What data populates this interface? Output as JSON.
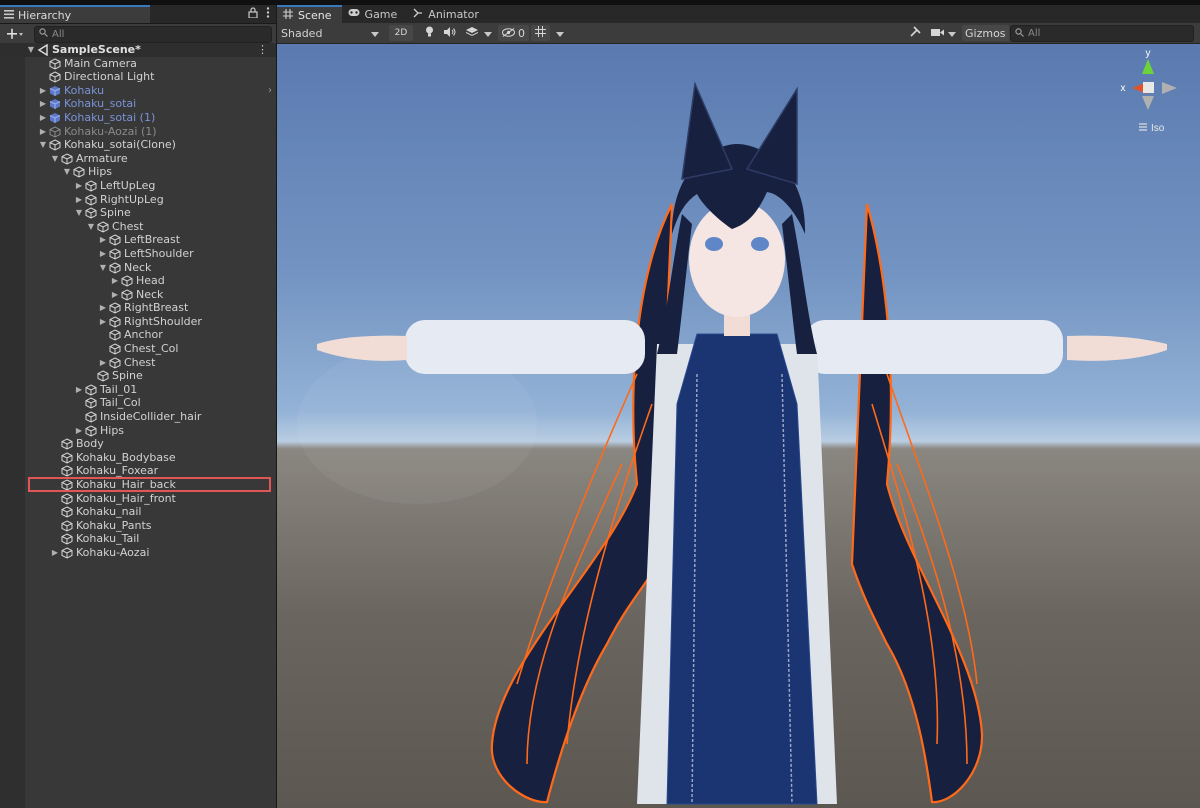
{
  "hierarchy": {
    "tab_label": "Hierarchy",
    "search_placeholder": "All",
    "rows": [
      {
        "label": "SampleScene*",
        "depth": 0,
        "arrow": "open",
        "icon": "scene",
        "kind": "scene"
      },
      {
        "label": "Main Camera",
        "depth": 1,
        "arrow": "none",
        "icon": "cube",
        "kind": "normal"
      },
      {
        "label": "Directional Light",
        "depth": 1,
        "arrow": "none",
        "icon": "cube",
        "kind": "normal"
      },
      {
        "label": "Kohaku",
        "depth": 1,
        "arrow": "closed",
        "icon": "prefab",
        "kind": "prefab"
      },
      {
        "label": "Kohaku_sotai",
        "depth": 1,
        "arrow": "closed",
        "icon": "prefab",
        "kind": "prefab"
      },
      {
        "label": "Kohaku_sotai (1)",
        "depth": 1,
        "arrow": "closed",
        "icon": "prefab",
        "kind": "prefab"
      },
      {
        "label": "Kohaku-Aozai (1)",
        "depth": 1,
        "arrow": "closed",
        "icon": "cube",
        "kind": "dim"
      },
      {
        "label": "Kohaku_sotai(Clone)",
        "depth": 1,
        "arrow": "open",
        "icon": "cube",
        "kind": "normal"
      },
      {
        "label": "Armature",
        "depth": 2,
        "arrow": "open",
        "icon": "cube",
        "kind": "normal"
      },
      {
        "label": "Hips",
        "depth": 3,
        "arrow": "open",
        "icon": "cube",
        "kind": "normal"
      },
      {
        "label": "LeftUpLeg",
        "depth": 4,
        "arrow": "closed",
        "icon": "cube",
        "kind": "normal"
      },
      {
        "label": "RightUpLeg",
        "depth": 4,
        "arrow": "closed",
        "icon": "cube",
        "kind": "normal"
      },
      {
        "label": "Spine",
        "depth": 4,
        "arrow": "open",
        "icon": "cube",
        "kind": "normal"
      },
      {
        "label": "Chest",
        "depth": 5,
        "arrow": "open",
        "icon": "cube",
        "kind": "normal"
      },
      {
        "label": "LeftBreast",
        "depth": 6,
        "arrow": "closed",
        "icon": "cube",
        "kind": "normal"
      },
      {
        "label": "LeftShoulder",
        "depth": 6,
        "arrow": "closed",
        "icon": "cube",
        "kind": "normal"
      },
      {
        "label": "Neck",
        "depth": 6,
        "arrow": "open",
        "icon": "cube",
        "kind": "normal"
      },
      {
        "label": "Head",
        "depth": 7,
        "arrow": "closed",
        "icon": "cube",
        "kind": "normal"
      },
      {
        "label": "Neck",
        "depth": 7,
        "arrow": "closed",
        "icon": "cube",
        "kind": "normal"
      },
      {
        "label": "RightBreast",
        "depth": 6,
        "arrow": "closed",
        "icon": "cube",
        "kind": "normal"
      },
      {
        "label": "RightShoulder",
        "depth": 6,
        "arrow": "closed",
        "icon": "cube",
        "kind": "normal"
      },
      {
        "label": "Anchor",
        "depth": 6,
        "arrow": "none",
        "icon": "cube",
        "kind": "normal"
      },
      {
        "label": "Chest_Col",
        "depth": 6,
        "arrow": "none",
        "icon": "cube",
        "kind": "normal"
      },
      {
        "label": "Chest",
        "depth": 6,
        "arrow": "closed",
        "icon": "cube",
        "kind": "normal"
      },
      {
        "label": "Spine",
        "depth": 5,
        "arrow": "none",
        "icon": "cube",
        "kind": "normal"
      },
      {
        "label": "Tail_01",
        "depth": 4,
        "arrow": "closed",
        "icon": "cube",
        "kind": "normal"
      },
      {
        "label": "Tail_Col",
        "depth": 4,
        "arrow": "none",
        "icon": "cube",
        "kind": "normal"
      },
      {
        "label": "InsideCollider_hair",
        "depth": 4,
        "arrow": "none",
        "icon": "cube",
        "kind": "normal"
      },
      {
        "label": "Hips",
        "depth": 4,
        "arrow": "closed",
        "icon": "cube",
        "kind": "normal"
      },
      {
        "label": "Body",
        "depth": 2,
        "arrow": "none",
        "icon": "cube",
        "kind": "normal"
      },
      {
        "label": "Kohaku_Bodybase",
        "depth": 2,
        "arrow": "none",
        "icon": "cube",
        "kind": "normal"
      },
      {
        "label": "Kohaku_Foxear",
        "depth": 2,
        "arrow": "none",
        "icon": "cube",
        "kind": "normal"
      },
      {
        "label": "Kohaku_Hair_back",
        "depth": 2,
        "arrow": "none",
        "icon": "cube",
        "kind": "selected"
      },
      {
        "label": "Kohaku_Hair_front",
        "depth": 2,
        "arrow": "none",
        "icon": "cube",
        "kind": "normal"
      },
      {
        "label": "Kohaku_nail",
        "depth": 2,
        "arrow": "none",
        "icon": "cube",
        "kind": "normal"
      },
      {
        "label": "Kohaku_Pants",
        "depth": 2,
        "arrow": "none",
        "icon": "cube",
        "kind": "normal"
      },
      {
        "label": "Kohaku_Tail",
        "depth": 2,
        "arrow": "none",
        "icon": "cube",
        "kind": "normal"
      },
      {
        "label": "Kohaku-Aozai",
        "depth": 2,
        "arrow": "closed",
        "icon": "cube",
        "kind": "normal"
      }
    ]
  },
  "scene_view": {
    "tabs": [
      {
        "label": "Scene",
        "icon": "grid-icon",
        "active": true
      },
      {
        "label": "Game",
        "icon": "gamepad-icon",
        "active": false
      },
      {
        "label": "Animator",
        "icon": "animator-icon",
        "active": false
      }
    ],
    "draw_mode": "Shaded",
    "mode_2d": "2D",
    "hidden_count": "0",
    "gizmos_label": "Gizmos",
    "search_placeholder": "All",
    "gizmo": {
      "axis_y": "y",
      "axis_x": "x",
      "projection_label": "Iso"
    }
  },
  "colors": {
    "accent": "#3a79bb",
    "selection_outline": "#e05656",
    "prefab_text": "#7b93d6",
    "object_outline": "#ff6a1a",
    "hair": "#17203e",
    "dress": "#1b3472",
    "sleeve": "#e6ebf3",
    "skin": "#f2ddd6",
    "axis_y": "#6cd43a",
    "axis_x": "#e0532a"
  }
}
